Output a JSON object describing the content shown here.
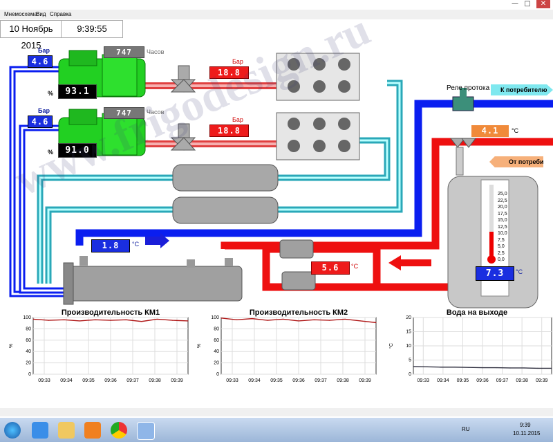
{
  "window": {
    "min": "—",
    "max": "□",
    "close": "✕"
  },
  "menu": {
    "items": [
      "Мнемосхема",
      "Вид",
      "Справка"
    ]
  },
  "status": {
    "date": "10 Ноябрь 2015",
    "time": "9:39:55"
  },
  "compressors": [
    {
      "pressure_label": "Бар",
      "pressure": "4.6",
      "hours": "747",
      "hours_label": "Часов",
      "load_label": "%",
      "load": "93.1",
      "discharge_label": "Бар",
      "discharge": "18.8"
    },
    {
      "pressure_label": "Бар",
      "pressure": "4.6",
      "hours": "747",
      "hours_label": "Часов",
      "load_label": "%",
      "load": "91.0",
      "discharge_label": "Бар",
      "discharge": "18.8"
    }
  ],
  "flow": {
    "relay_label": "Реле протока",
    "to_consumer": "К потребителю",
    "from_consumer": "От потребителя",
    "supply_temp": "4.1",
    "supply_unit": "°C",
    "evap_temp": "1.8",
    "evap_unit": "°C",
    "return_temp": "5.6",
    "return_unit": "°C"
  },
  "tank": {
    "scale": [
      "25,0",
      "22,5",
      "20,0",
      "17,5",
      "15,0",
      "12,5",
      "10,0",
      "7,5",
      "5,0",
      "2,5",
      "0,0"
    ],
    "temp": "7.3",
    "unit": "°C"
  },
  "colors": {
    "cold": "#0a1ef0",
    "hot": "#ee1010",
    "aqua": "#4ec8d0",
    "pink": "#f08a8a",
    "compressor": "#22d022"
  },
  "watermark": "www.frigodesign.ru",
  "chart_data": [
    {
      "type": "line",
      "title": "Производительность КМ1",
      "ylabel": "%",
      "xlabel": "",
      "categories": [
        "09:33",
        "09:34",
        "09:35",
        "09:36",
        "09:37",
        "09:38",
        "09:39"
      ],
      "ylim": [
        0,
        100
      ],
      "yticks": [
        0,
        20,
        40,
        60,
        80,
        100
      ],
      "series": [
        {
          "values": [
            97,
            95,
            96,
            94,
            96,
            95,
            96,
            93,
            97,
            95,
            94
          ]
        }
      ]
    },
    {
      "type": "line",
      "title": "Производительность КМ2",
      "ylabel": "%",
      "xlabel": "",
      "categories": [
        "09:33",
        "09:34",
        "09:35",
        "09:36",
        "09:37",
        "09:38",
        "09:39"
      ],
      "ylim": [
        0,
        100
      ],
      "yticks": [
        0,
        20,
        40,
        60,
        80,
        100
      ],
      "series": [
        {
          "values": [
            99,
            96,
            98,
            95,
            97,
            94,
            96,
            95,
            97,
            94,
            91
          ]
        }
      ]
    },
    {
      "type": "line",
      "title": "Вода на выходе",
      "ylabel": "°C",
      "xlabel": "",
      "categories": [
        "09:33",
        "09:34",
        "09:35",
        "09:36",
        "09:37",
        "09:38",
        "09:39"
      ],
      "ylim": [
        0,
        20
      ],
      "yticks": [
        0,
        5,
        10,
        15,
        20
      ],
      "series": [
        {
          "values": [
            2.7,
            2.6,
            2.5,
            2.5,
            2.4,
            2.3,
            2.3,
            2.2,
            2.2,
            2.1,
            2.1
          ]
        }
      ]
    }
  ],
  "taskbar": {
    "lang": "RU",
    "clock": "9:39",
    "date": "10.11.2015"
  }
}
